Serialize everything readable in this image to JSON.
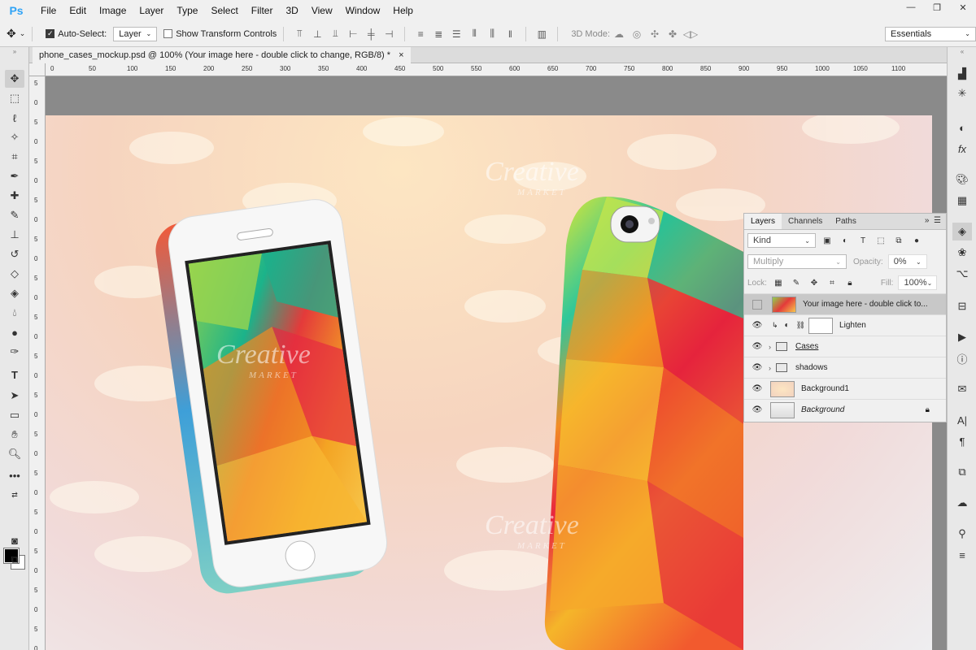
{
  "app": {
    "logo": "Ps"
  },
  "menu": [
    "File",
    "Edit",
    "Image",
    "Layer",
    "Type",
    "Select",
    "Filter",
    "3D",
    "View",
    "Window",
    "Help"
  ],
  "window_controls": {
    "minimize": "—",
    "restore": "❐",
    "close": "✕"
  },
  "options_bar": {
    "auto_select_label": "Auto-Select:",
    "auto_select_checked": true,
    "auto_select_target": "Layer",
    "show_transform_label": "Show Transform Controls",
    "show_transform_checked": false,
    "mode_3d_label": "3D Mode:",
    "workspace": "Essentials"
  },
  "document_tab": {
    "title": "phone_cases_mockup.psd @ 100% (Your image here - double click to change, RGB/8) *",
    "close": "×"
  },
  "rulers": {
    "top": [
      "0",
      "50",
      "100",
      "150",
      "200",
      "250",
      "300",
      "350",
      "400",
      "450",
      "500",
      "550",
      "600",
      "650",
      "700",
      "750",
      "800",
      "850",
      "900",
      "950",
      "1000",
      "1050",
      "1100"
    ],
    "left": [
      "5",
      "0",
      "5",
      "0",
      "5",
      "0",
      "5",
      "0",
      "5",
      "0",
      "5",
      "0",
      "5",
      "0",
      "5",
      "0",
      "5",
      "0",
      "5",
      "0",
      "5",
      "0",
      "5",
      "0",
      "5",
      "0",
      "5",
      "0",
      "5",
      "0"
    ]
  },
  "watermark": {
    "line1": "Creative",
    "line2": "MARKET"
  },
  "layers_panel": {
    "tabs": [
      "Layers",
      "Channels",
      "Paths"
    ],
    "filter_kind": "Kind",
    "blend_mode": "Multiply",
    "opacity_label": "Opacity:",
    "opacity_value": "0%",
    "lock_label": "Lock:",
    "fill_label": "Fill:",
    "fill_value": "100%",
    "layers": [
      {
        "name": "Your image here - double click to...",
        "visible": false,
        "selected": true,
        "kind": "smart"
      },
      {
        "name": "Lighten",
        "visible": true,
        "selected": false,
        "kind": "adjustment"
      },
      {
        "name": "Cases",
        "visible": true,
        "selected": false,
        "kind": "group"
      },
      {
        "name": "shadows",
        "visible": true,
        "selected": false,
        "kind": "group"
      },
      {
        "name": "Background1",
        "visible": true,
        "selected": false,
        "kind": "pixel"
      },
      {
        "name": "Background",
        "visible": true,
        "selected": false,
        "kind": "background",
        "locked": true
      }
    ]
  },
  "colors": {
    "ps_blue": "#2fa3f6",
    "foreground": "#000000",
    "background": "#ffffff"
  },
  "icons": {
    "tools": [
      "move-icon",
      "marquee-icon",
      "lasso-icon",
      "magic-wand-icon",
      "crop-icon",
      "eyedropper-icon",
      "healing-brush-icon",
      "brush-icon",
      "clone-stamp-icon",
      "history-brush-icon",
      "eraser-icon",
      "paint-bucket-icon",
      "blur-icon",
      "dodge-icon",
      "pen-icon",
      "type-icon",
      "path-selection-icon",
      "rectangle-icon",
      "hand-icon",
      "zoom-icon",
      "more-tools-icon"
    ],
    "side": [
      "collapse-icon",
      "histogram-icon",
      "navigator-icon",
      "adjustments-icon",
      "styles-icon",
      "swatches-icon",
      "color-icon",
      "layers-icon",
      "channels-icon",
      "paths-icon",
      "properties-icon",
      "actions-icon",
      "info-icon",
      "notes-icon",
      "character-icon",
      "paragraph-icon",
      "glyphs-icon",
      "libraries-icon",
      "brush-settings-icon",
      "tool-presets-icon"
    ]
  }
}
